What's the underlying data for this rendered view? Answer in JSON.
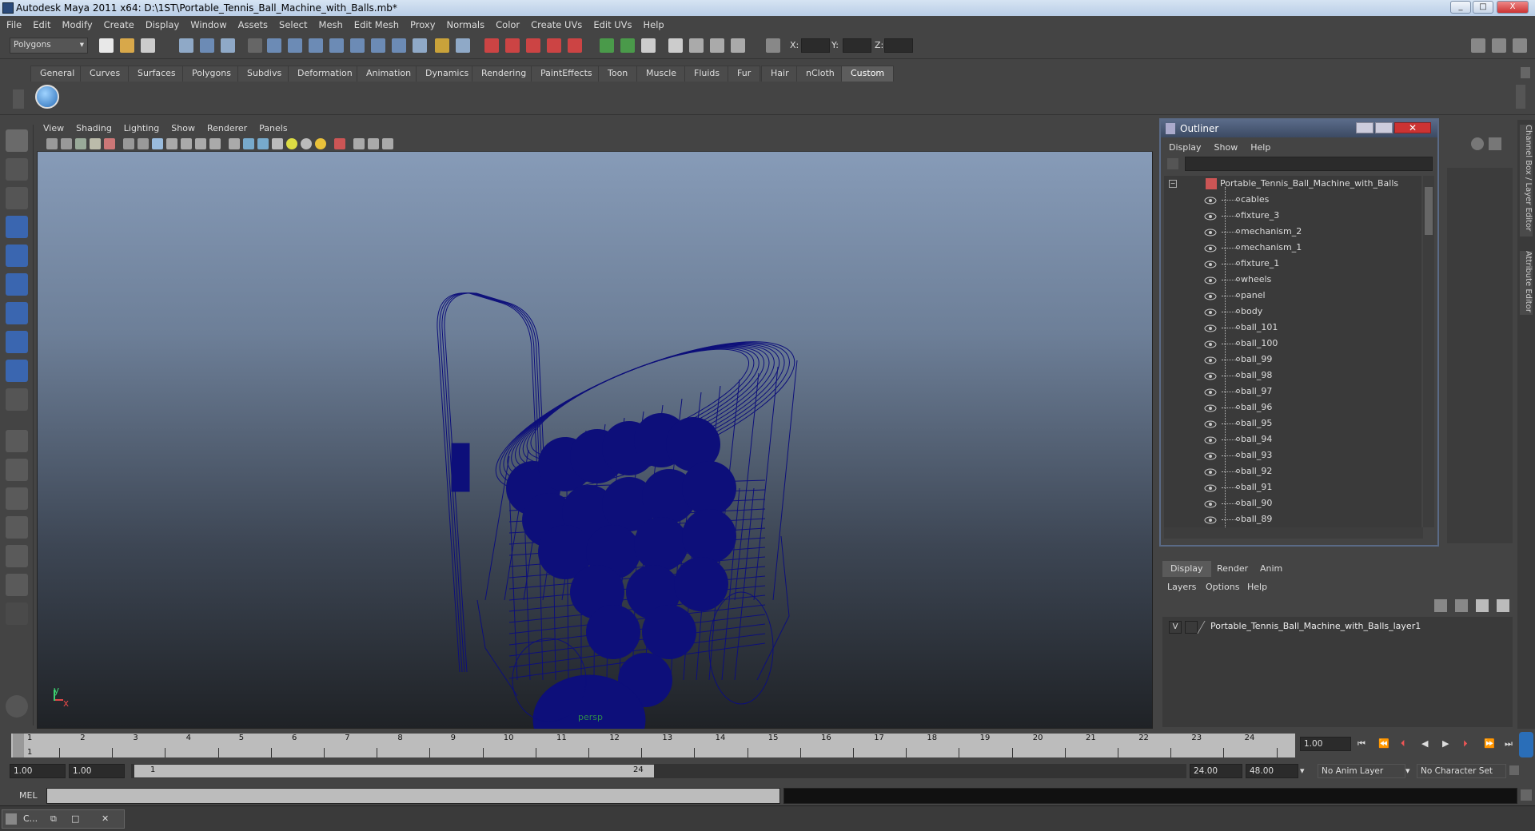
{
  "window": {
    "title": "Autodesk Maya 2011 x64: D:\\1ST\\Portable_Tennis_Ball_Machine_with_Balls.mb*",
    "minimize": "_",
    "maximize": "□",
    "close": "X"
  },
  "menubar": [
    "File",
    "Edit",
    "Modify",
    "Create",
    "Display",
    "Window",
    "Assets",
    "Select",
    "Mesh",
    "Edit Mesh",
    "Proxy",
    "Normals",
    "Color",
    "Create UVs",
    "Edit UVs",
    "Help"
  ],
  "statusline": {
    "mode": "Polygons",
    "x_label": "X:",
    "y_label": "Y:",
    "z_label": "Z:"
  },
  "shelf_tabs": [
    "General",
    "Curves",
    "Surfaces",
    "Polygons",
    "Subdivs",
    "Deformation",
    "Animation",
    "Dynamics",
    "Rendering",
    "PaintEffects",
    "Toon",
    "Muscle",
    "Fluids",
    "Fur",
    "Hair",
    "nCloth",
    "Custom"
  ],
  "shelf_active": "Custom",
  "viewport": {
    "menu": [
      "View",
      "Shading",
      "Lighting",
      "Show",
      "Renderer",
      "Panels"
    ],
    "camera_label": "persp",
    "axis_x": "x",
    "axis_y": "y",
    "wire_color": "#0d0f7a"
  },
  "outliner": {
    "title": "Outliner",
    "menu": [
      "Display",
      "Show",
      "Help"
    ],
    "root": "Portable_Tennis_Ball_Machine_with_Balls",
    "items": [
      "cables",
      "fixture_3",
      "mechanism_2",
      "mechanism_1",
      "fixture_1",
      "wheels",
      "panel",
      "body",
      "ball_101",
      "ball_100",
      "ball_99",
      "ball_98",
      "ball_97",
      "ball_96",
      "ball_95",
      "ball_94",
      "ball_93",
      "ball_92",
      "ball_91",
      "ball_90",
      "ball_89"
    ]
  },
  "layer_editor": {
    "tabs": [
      "Display",
      "Render",
      "Anim"
    ],
    "menu": [
      "Layers",
      "Options",
      "Help"
    ],
    "layer": {
      "visibility": "V",
      "name": "Portable_Tennis_Ball_Machine_with_Balls_layer1"
    }
  },
  "side_tabs": [
    "Channel Box / Layer Editor",
    "Attribute Editor"
  ],
  "time_slider": {
    "ticks": [
      "1",
      "2",
      "3",
      "4",
      "5",
      "6",
      "7",
      "8",
      "9",
      "10",
      "11",
      "12",
      "13",
      "14",
      "15",
      "16",
      "17",
      "18",
      "19",
      "20",
      "21",
      "22",
      "23",
      "24"
    ],
    "current_frame": "1",
    "current_time": "1.00"
  },
  "range_slider": {
    "start": "1.00",
    "start2": "1.00",
    "range_start": "1",
    "range_end": "24",
    "end": "24.00",
    "end2": "48.00",
    "anim_layer": "No Anim Layer",
    "char_set": "No Character Set"
  },
  "cmdline": {
    "label": "MEL"
  },
  "taskbar": {
    "item": "C..."
  }
}
